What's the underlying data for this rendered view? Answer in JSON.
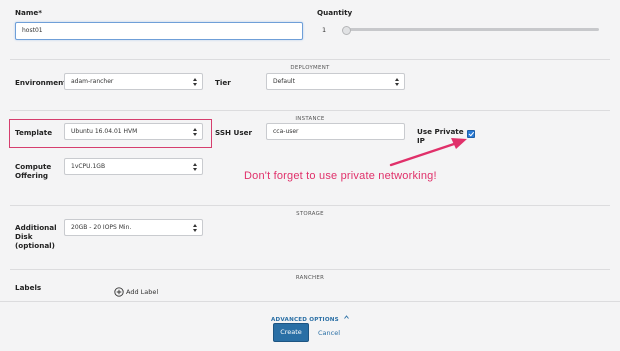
{
  "form": {
    "name_label": "Name*",
    "name_value": "host01",
    "quantity_label": "Quantity",
    "quantity_value": "1",
    "quantity_fraction": 0
  },
  "sections": {
    "deployment": "DEPLOYMENT",
    "instance": "INSTANCE",
    "storage": "STORAGE",
    "rancher": "RANCHER"
  },
  "deployment": {
    "environment_label": "Environment",
    "environment_value": "adam-rancher",
    "tier_label": "Tier",
    "tier_value": "Default"
  },
  "instance": {
    "template_label": "Template",
    "template_value": "Ubuntu 16.04.01 HVM",
    "ssh_user_label": "SSH User",
    "ssh_user_value": "cca-user",
    "use_private_ip_label_1": "Use Private",
    "use_private_ip_label_2": "IP",
    "use_private_ip_checked": true,
    "compute_label_1": "Compute",
    "compute_label_2": "Offering",
    "compute_value": "1vCPU.1GB"
  },
  "annotation": {
    "text": "Don't forget to use private networking!",
    "color": "#e0306a"
  },
  "storage": {
    "disk_label_1": "Additional",
    "disk_label_2": "Disk",
    "disk_label_3": "(optional)",
    "disk_value": "20GB - 20 IOPS Min."
  },
  "rancher": {
    "labels_label": "Labels",
    "add_label": "Add Label"
  },
  "footer": {
    "advanced_options": "ADVANCED OPTIONS",
    "create": "Create",
    "cancel": "Cancel"
  },
  "colors": {
    "accent": "#2a6fa5",
    "highlight_box": "#d63e6e",
    "focus_border": "#6f9fd8"
  },
  "icons": {
    "add": "plus-circle-icon",
    "caret": "chevron-up-icon",
    "select": "select-arrows-icon"
  }
}
